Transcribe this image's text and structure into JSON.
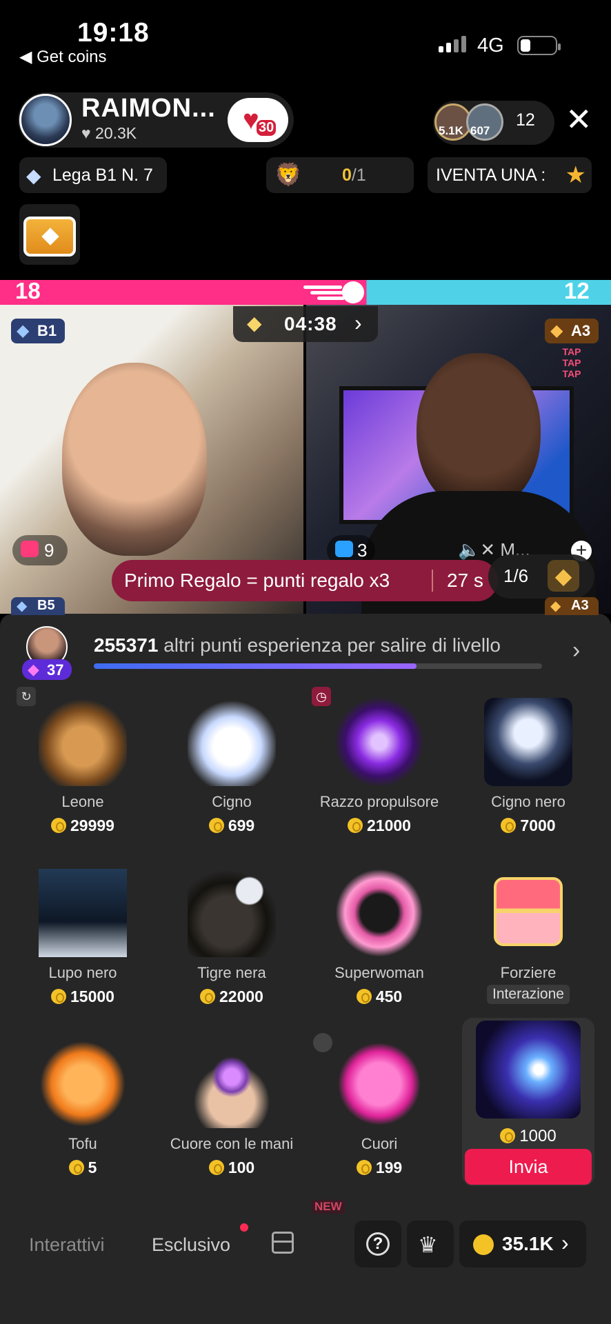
{
  "status_bar": {
    "time": "19:18",
    "back_app": "Get coins",
    "network": "4G"
  },
  "host": {
    "name": "RAIMON...",
    "likes": "20.3K",
    "like_badge": "30"
  },
  "viewers": {
    "v1": "5.1K",
    "v2": "607",
    "count": "12"
  },
  "chips": {
    "league": "Lega B1 N. 7",
    "goal_done": "0",
    "goal_total": "/1",
    "banner": "IVENTA UNA :"
  },
  "battle": {
    "score_left": "18",
    "score_right": "12",
    "timer": "04:38",
    "left_badge": "B1",
    "right_badge": "A3",
    "tap": "TAP TAP TAP",
    "left_gifts": "9",
    "right_gifts": "3",
    "right_name": "M...",
    "promo_text": "Primo Regalo = punti regalo x3",
    "promo_time": "27 s",
    "pager": "1/6",
    "lower_left_badge": "B5",
    "lower_right_badge": "A3"
  },
  "xp": {
    "level": "37",
    "points": "255371",
    "text": "altri punti esperienza per salire di livello",
    "progress": 0.72
  },
  "gifts": [
    {
      "name": "Leone",
      "price": "29999"
    },
    {
      "name": "Cigno",
      "price": "699"
    },
    {
      "name": "Razzo propulsore",
      "price": "21000"
    },
    {
      "name": "Cigno nero",
      "price": "7000"
    },
    {
      "name": "Lupo nero",
      "price": "15000"
    },
    {
      "name": "Tigre nera",
      "price": "22000"
    },
    {
      "name": "Superwoman",
      "price": "450"
    },
    {
      "name": "Forziere",
      "tag": "Interazione"
    },
    {
      "name": "Tofu",
      "price": "5"
    },
    {
      "name": "Cuore con le mani",
      "price": "100"
    },
    {
      "name": "Cuori",
      "price": "199"
    }
  ],
  "selected_gift": {
    "price": "1000",
    "send": "Invia"
  },
  "new_tag": "NEW",
  "bottom_nav": {
    "tab1": "Interattivi",
    "tab2": "Esclusivo",
    "balance": "35.1K"
  },
  "colors": {
    "accent": "#ee1b4f",
    "score_left": "#ff2e87",
    "score_right": "#4fd2e8",
    "panel": "#262626"
  }
}
